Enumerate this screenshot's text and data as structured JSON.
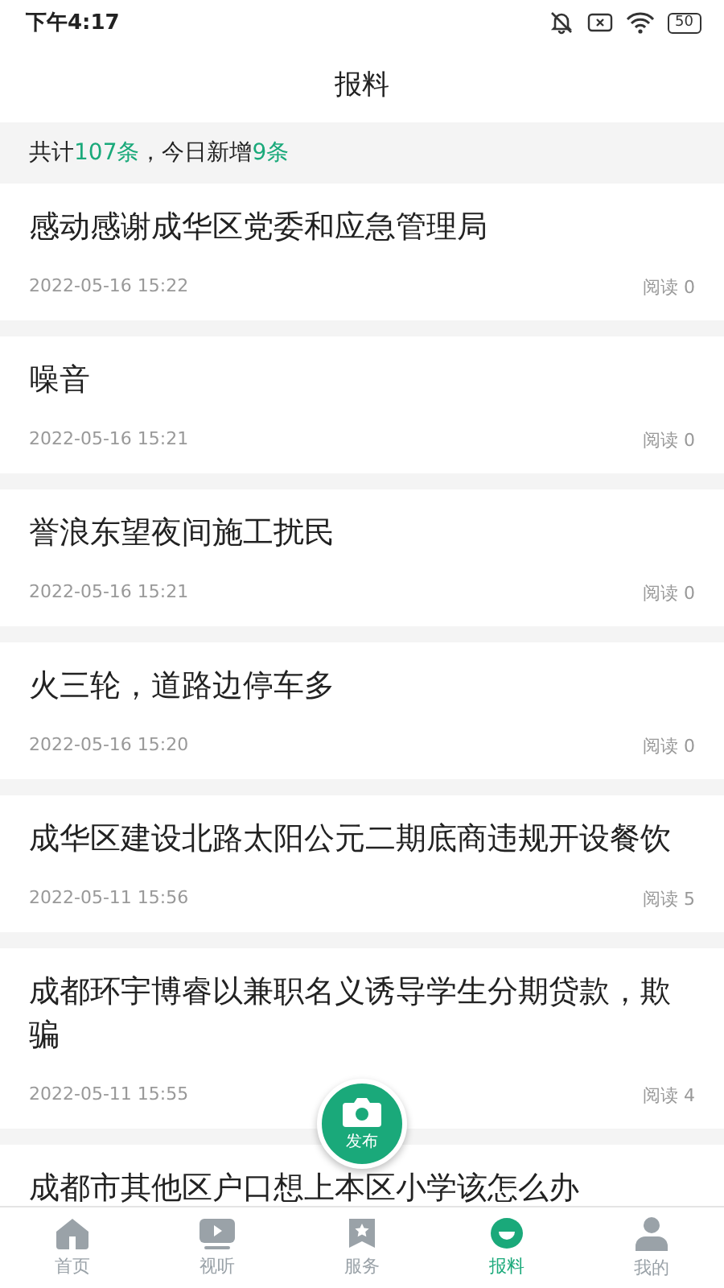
{
  "status_bar": {
    "time": "下午4:17",
    "battery": "50"
  },
  "header": {
    "title": "报料"
  },
  "summary": "共计**107条**，今日新增**9条**",
  "posts": [
    {
      "title": "感动感谢成华区党委和应急管理局",
      "date": "2022-05-16 15:22",
      "reads": "阅读 0"
    },
    {
      "title": "噪音",
      "date": "2022-05-16 15:21",
      "reads": "阅读 0"
    },
    {
      "title": "誉浪东望夜间施工扰民",
      "date": "2022-05-16 15:21",
      "reads": "阅读 0"
    },
    {
      "title": "火三轮，道路边停车多",
      "date": "2022-05-16 15:20",
      "reads": "阅读 0"
    },
    {
      "title": "成华区建设北路太阳公元二期底商违规开设餐饮",
      "date": "2022-05-11 15:56",
      "reads": "阅读 5"
    },
    {
      "title": "成都环宇博睿以兼职名义诱导学生分期贷款，欺骗",
      "date": "2022-05-11 15:55",
      "reads": "阅读 4"
    },
    {
      "title": "成都市其他区户口想上本区小学该怎么办"
    }
  ],
  "publish_button": {
    "label": "发布"
  },
  "tabs": [
    {
      "label": "首页",
      "kind": "home",
      "selected": false
    },
    {
      "label": "视听",
      "kind": "video",
      "selected": false
    },
    {
      "label": "服务",
      "kind": "star",
      "selected": false
    },
    {
      "label": "报料",
      "kind": "chat",
      "selected": true
    },
    {
      "label": "我的",
      "kind": "person",
      "selected": false
    }
  ]
}
